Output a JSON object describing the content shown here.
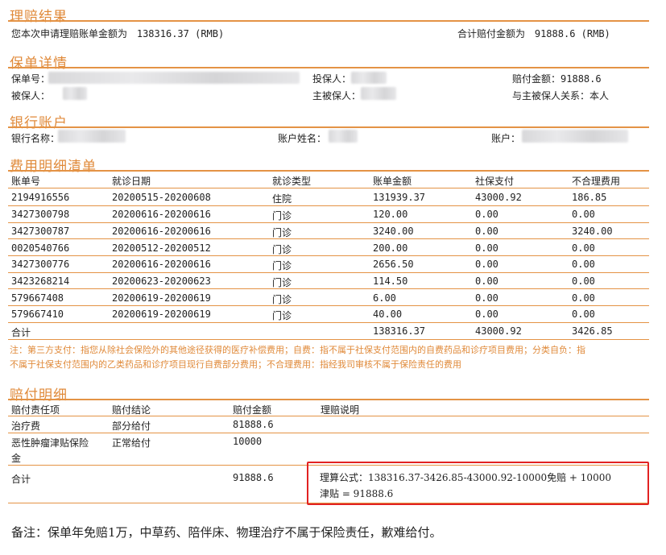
{
  "claim_result": {
    "title": "理赔结果",
    "bill_amount_label": "您本次申请理赔账单金额为",
    "bill_amount_value": "138316.37 (RMB)",
    "total_paid_label": "合计赔付金额为",
    "total_paid_value": "91888.6 (RMB)"
  },
  "policy_details": {
    "title": "保单详情",
    "policy_no_label": "保单号：",
    "policyholder_label": "投保人：",
    "payout_label": "赔付金额：",
    "payout_value": "91888.6",
    "insured_label": "被保人：",
    "main_insured_label": "主被保人：",
    "relation_label": "与主被保人关系：",
    "relation_value": "本人"
  },
  "bank_account": {
    "title": "银行账户",
    "bank_name_label": "银行名称：",
    "account_name_label": "账户姓名：",
    "account_label": "账户："
  },
  "expense_list": {
    "title": "费用明细清单",
    "headers": [
      "账单号",
      "就诊日期",
      "就诊类型",
      "账单金额",
      "社保支付",
      "不合理费用"
    ],
    "rows": [
      [
        "2194916556",
        "20200515-20200608",
        "住院",
        "131939.37",
        "43000.92",
        "186.85"
      ],
      [
        "3427300798",
        "20200616-20200616",
        "门诊",
        "120.00",
        "0.00",
        "0.00"
      ],
      [
        "3427300787",
        "20200616-20200616",
        "门诊",
        "3240.00",
        "0.00",
        "3240.00"
      ],
      [
        "0020540766",
        "20200512-20200512",
        "门诊",
        "200.00",
        "0.00",
        "0.00"
      ],
      [
        "3427300776",
        "20200616-20200616",
        "门诊",
        "2656.50",
        "0.00",
        "0.00"
      ],
      [
        "3423268214",
        "20200623-20200623",
        "门诊",
        "114.50",
        "0.00",
        "0.00"
      ],
      [
        "579667408",
        "20200619-20200619",
        "门诊",
        "6.00",
        "0.00",
        "0.00"
      ],
      [
        "579667410",
        "20200619-20200619",
        "门诊",
        "40.00",
        "0.00",
        "0.00"
      ]
    ],
    "total_label": "合计",
    "total_bill": "138316.37",
    "total_social": "43000.92",
    "total_unreasonable": "3426.85",
    "note_line1": "注：第三方支付：指您从除社会保险外的其他途径获得的医疗补偿费用；自费：指不属于社保支付范围内的自费药品和诊疗项目费用；分类自负：指",
    "note_line2": "不属于社保支付范围内的乙类药品和诊疗项目现行自费部分费用；不合理费用：指经我司审核不属于保险责任的费用"
  },
  "payout_details": {
    "title": "赔付明细",
    "headers": [
      "赔付责任项",
      "赔付结论",
      "赔付金额",
      "理赔说明"
    ],
    "row1": {
      "item": "治疗费",
      "conclusion": "部分给付",
      "amount": "81888.6"
    },
    "row2": {
      "item_line1": "恶性肿瘤津贴保险",
      "item_line2": "金",
      "conclusion": "正常给付",
      "amount": "10000"
    },
    "total_label": "合计",
    "total_amount": "91888.6",
    "formula_line1": "理算公式：138316.37-3426.85-43000.92-10000免赔 + 10000",
    "formula_line2": "津贴 = 91888.6"
  },
  "remark": "备注：保单年免赔1万，中草药、陪伴床、物理治疗不属于保险责任，歉难给付。",
  "colors": {
    "accent": "#e49345",
    "title": "#e08a3a",
    "highlight_border": "#e22222"
  }
}
